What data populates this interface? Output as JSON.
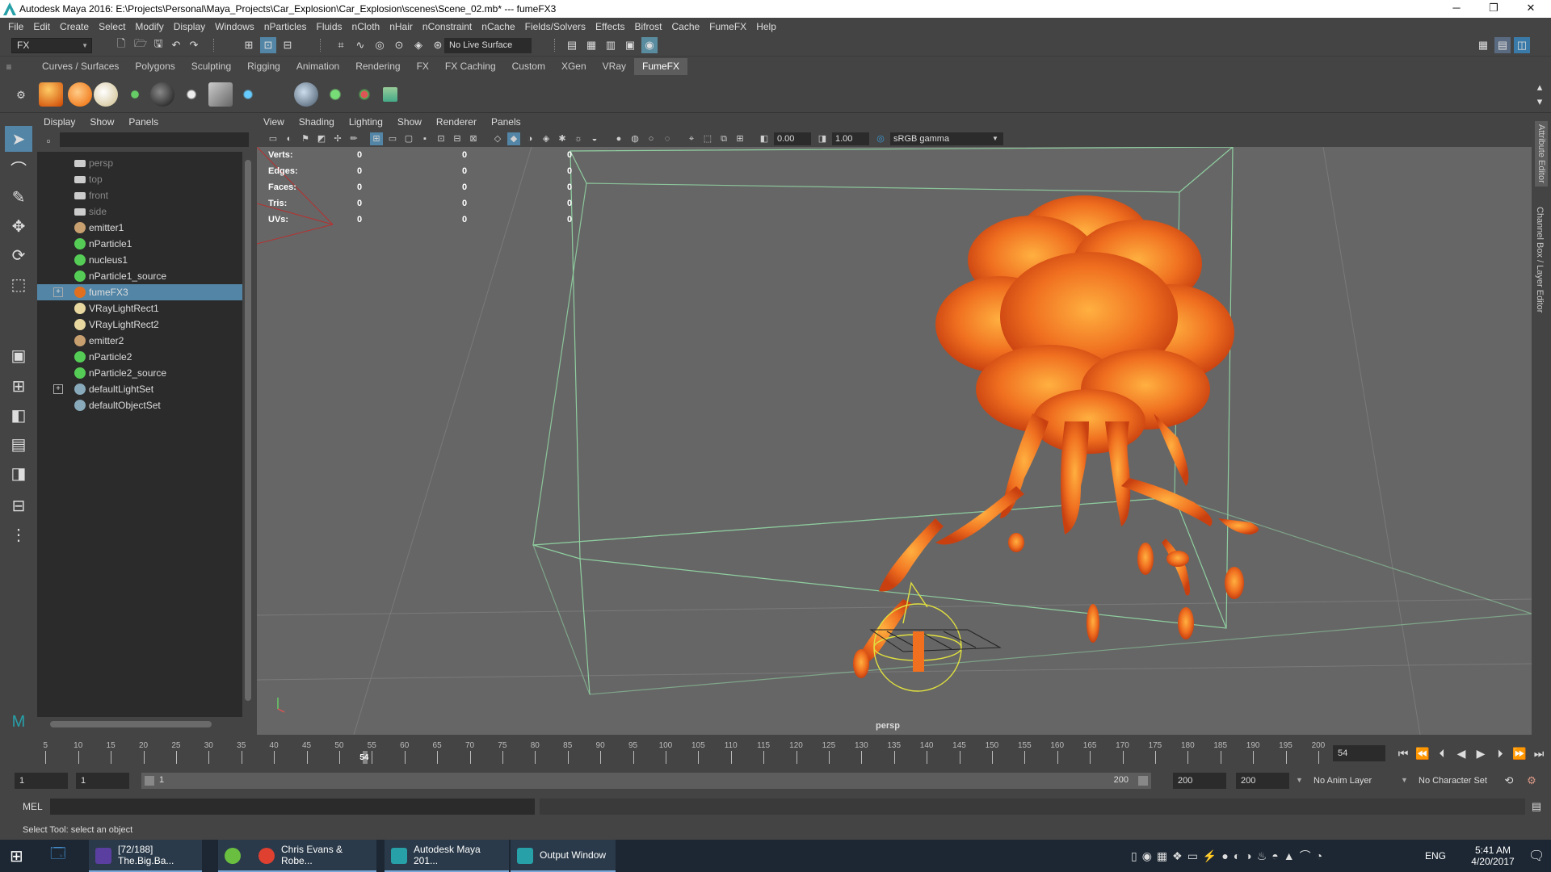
{
  "window": {
    "title": "Autodesk Maya 2016: E:\\Projects\\Personal\\Maya_Projects\\Car_Explosion\\Car_Explosion\\scenes\\Scene_02.mb*    ---    fumeFX3"
  },
  "menubar": [
    "File",
    "Edit",
    "Create",
    "Select",
    "Modify",
    "Display",
    "Windows",
    "nParticles",
    "Fluids",
    "nCloth",
    "nHair",
    "nConstraint",
    "nCache",
    "Fields/Solvers",
    "Effects",
    "Bifrost",
    "Cache",
    "FumeFX",
    "Help"
  ],
  "toolbar": {
    "mode": "FX",
    "live_surface": "No Live Surface"
  },
  "shelf_tabs": [
    "Curves / Surfaces",
    "Polygons",
    "Sculpting",
    "Rigging",
    "Animation",
    "Rendering",
    "FX",
    "FX Caching",
    "Custom",
    "XGen",
    "VRay",
    "FumeFX"
  ],
  "shelf_active": "FumeFX",
  "outliner": {
    "menu": [
      "Display",
      "Show",
      "Panels"
    ],
    "items": [
      {
        "label": "persp",
        "icon": "camera-icon",
        "dim": true
      },
      {
        "label": "top",
        "icon": "camera-icon",
        "dim": true
      },
      {
        "label": "front",
        "icon": "camera-icon",
        "dim": true
      },
      {
        "label": "side",
        "icon": "camera-icon",
        "dim": true
      },
      {
        "label": "emitter1",
        "icon": "emitter-icon"
      },
      {
        "label": "nParticle1",
        "icon": "particle-icon"
      },
      {
        "label": "nucleus1",
        "icon": "nucleus-icon"
      },
      {
        "label": "nParticle1_source",
        "icon": "particle-source-icon"
      },
      {
        "label": "fumeFX3",
        "icon": "fumefx-icon",
        "selected": true,
        "expand": true
      },
      {
        "label": "VRayLightRect1",
        "icon": "light-icon"
      },
      {
        "label": "VRayLightRect2",
        "icon": "light-icon"
      },
      {
        "label": "emitter2",
        "icon": "emitter-icon"
      },
      {
        "label": "nParticle2",
        "icon": "particle-icon"
      },
      {
        "label": "nParticle2_source",
        "icon": "particle-source-icon"
      },
      {
        "label": "defaultLightSet",
        "icon": "set-icon",
        "expand": true
      },
      {
        "label": "defaultObjectSet",
        "icon": "set-icon"
      }
    ]
  },
  "viewport": {
    "menu": [
      "View",
      "Shading",
      "Lighting",
      "Show",
      "Renderer",
      "Panels"
    ],
    "near": "0.00",
    "gamma": "1.00",
    "color_space": "sRGB gamma",
    "hud": [
      {
        "label": "Verts:",
        "values": [
          "0",
          "0",
          "0"
        ]
      },
      {
        "label": "Edges:",
        "values": [
          "0",
          "0",
          "0"
        ]
      },
      {
        "label": "Faces:",
        "values": [
          "0",
          "0",
          "0"
        ]
      },
      {
        "label": "Tris:",
        "values": [
          "0",
          "0",
          "0"
        ]
      },
      {
        "label": "UVs:",
        "values": [
          "0",
          "0",
          "0"
        ]
      }
    ],
    "camera_label": "persp"
  },
  "right_tabs": [
    "Attribute Editor",
    "Channel Box / Layer Editor"
  ],
  "timeline": {
    "ticks": [
      "5",
      "10",
      "15",
      "20",
      "25",
      "30",
      "35",
      "40",
      "45",
      "50",
      "55",
      "60",
      "65",
      "70",
      "75",
      "80",
      "85",
      "90",
      "95",
      "100",
      "105",
      "110",
      "115",
      "120",
      "125",
      "130",
      "135",
      "140",
      "145",
      "150",
      "155",
      "160",
      "165",
      "170",
      "175",
      "180",
      "185",
      "190",
      "195",
      "200"
    ],
    "current_marker": "54",
    "current_frame": "54",
    "current_frame_value": 54
  },
  "range": {
    "start": "1",
    "playback_start": "1",
    "slider_label": "1",
    "slider_end": "200",
    "playback_end": "200",
    "end": "200",
    "anim_layer": "No Anim Layer",
    "char_set": "No Character Set"
  },
  "cmdline": {
    "label": "MEL"
  },
  "status": "Select Tool: select an object",
  "taskbar": {
    "apps": [
      {
        "label": "[72/188] The.Big.Ba...",
        "icon": "media-player-icon"
      },
      {
        "label": "",
        "icon": "utorrent-icon"
      },
      {
        "label": "Chris Evans & Robe...",
        "icon": "chrome-icon"
      },
      {
        "label": "Autodesk Maya 201...",
        "icon": "maya-icon"
      },
      {
        "label": "Output Window",
        "icon": "maya-output-icon"
      }
    ],
    "lang": "ENG",
    "time": "5:41 AM",
    "date": "4/20/2017"
  },
  "colors": {
    "selected": "#5285a6",
    "fire": "#f07020",
    "bbox": "#8fcfa0",
    "bg": "#444444"
  }
}
